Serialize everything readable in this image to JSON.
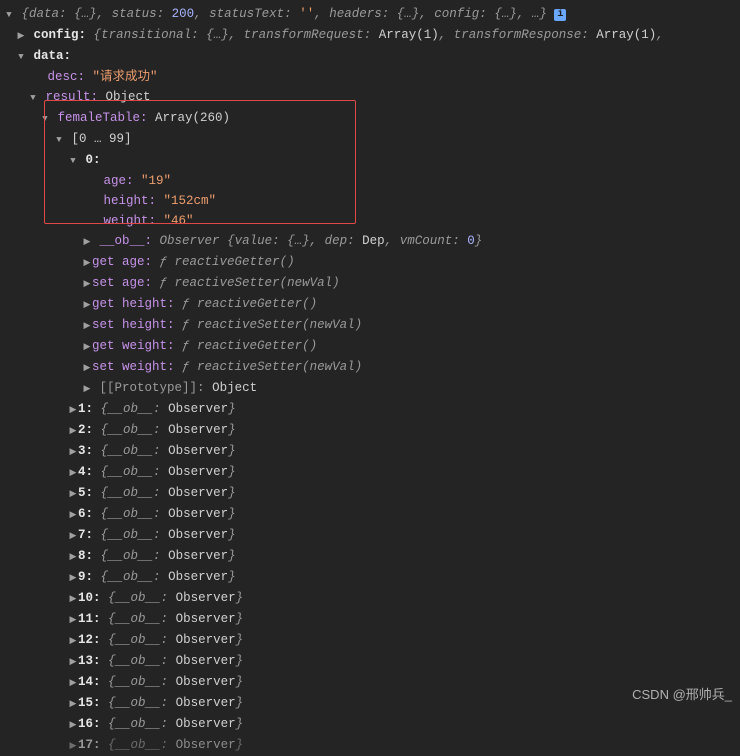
{
  "summary": {
    "open": "{",
    "data_k": "data:",
    "data_v": "{…}",
    "sep": ", ",
    "status_k": "status:",
    "status_v": "200",
    "statusText_k": "statusText:",
    "statusText_v": "''",
    "headers_k": "headers:",
    "headers_v": "{…}",
    "config_k": "config:",
    "config_v": "{…}",
    "ell": "…",
    "close": "}"
  },
  "config_line": {
    "key": "config:",
    "body_open": "{",
    "k1": "transitional:",
    "v1": "{…}",
    "k2": "transformRequest:",
    "v2": "Array(1)",
    "k3": "transformResponse:",
    "v3": "Array(1)",
    "body_close": ","
  },
  "data_line": {
    "key": "data:"
  },
  "desc": {
    "key": "desc:",
    "val": "\"请求成功\""
  },
  "result": {
    "key": "result:",
    "val": "Object"
  },
  "femaleTable": {
    "key": "femaleTable:",
    "val": "Array(260)"
  },
  "chunk": {
    "label": "[0 … 99]"
  },
  "item0": {
    "idx": "0:",
    "age_k": "age:",
    "age_v": "\"19\"",
    "height_k": "height:",
    "height_v": "\"152cm\"",
    "weight_k": "weight:",
    "weight_v": "\"46\""
  },
  "ob": {
    "key": "__ob__:",
    "head": "Observer ",
    "open": "{",
    "k1": "value:",
    "v1": "{…}",
    "k2": "dep:",
    "v2": "Dep",
    "k3": "vmCount:",
    "v3": "0",
    "close": "}"
  },
  "getset": {
    "age_g": "get age:",
    "age_g_v": "reactiveGetter()",
    "age_s": "set age:",
    "age_s_v": "reactiveSetter(newVal)",
    "h_g": "get height:",
    "h_g_v": "reactiveGetter()",
    "h_s": "set height:",
    "h_s_v": "reactiveSetter(newVal)",
    "w_g": "get weight:",
    "w_g_v": "reactiveGetter()",
    "w_s": "set weight:",
    "w_s_v": "reactiveSetter(newVal)",
    "fsym": "ƒ "
  },
  "proto": {
    "key": "[[Prototype]]:",
    "val": "Object"
  },
  "collapsed_open": "{",
  "collapsed_key": "__ob__:",
  "collapsed_val": "Observer",
  "collapsed_close": "}",
  "items": {
    "i1": "1:",
    "i2": "2:",
    "i3": "3:",
    "i4": "4:",
    "i5": "5:",
    "i6": "6:",
    "i7": "7:",
    "i8": "8:",
    "i9": "9:",
    "i10": "10:",
    "i11": "11:",
    "i12": "12:",
    "i13": "13:",
    "i14": "14:",
    "i15": "15:",
    "i16": "16:",
    "i17": "17:"
  },
  "watermark": "CSDN @邢帅兵_"
}
